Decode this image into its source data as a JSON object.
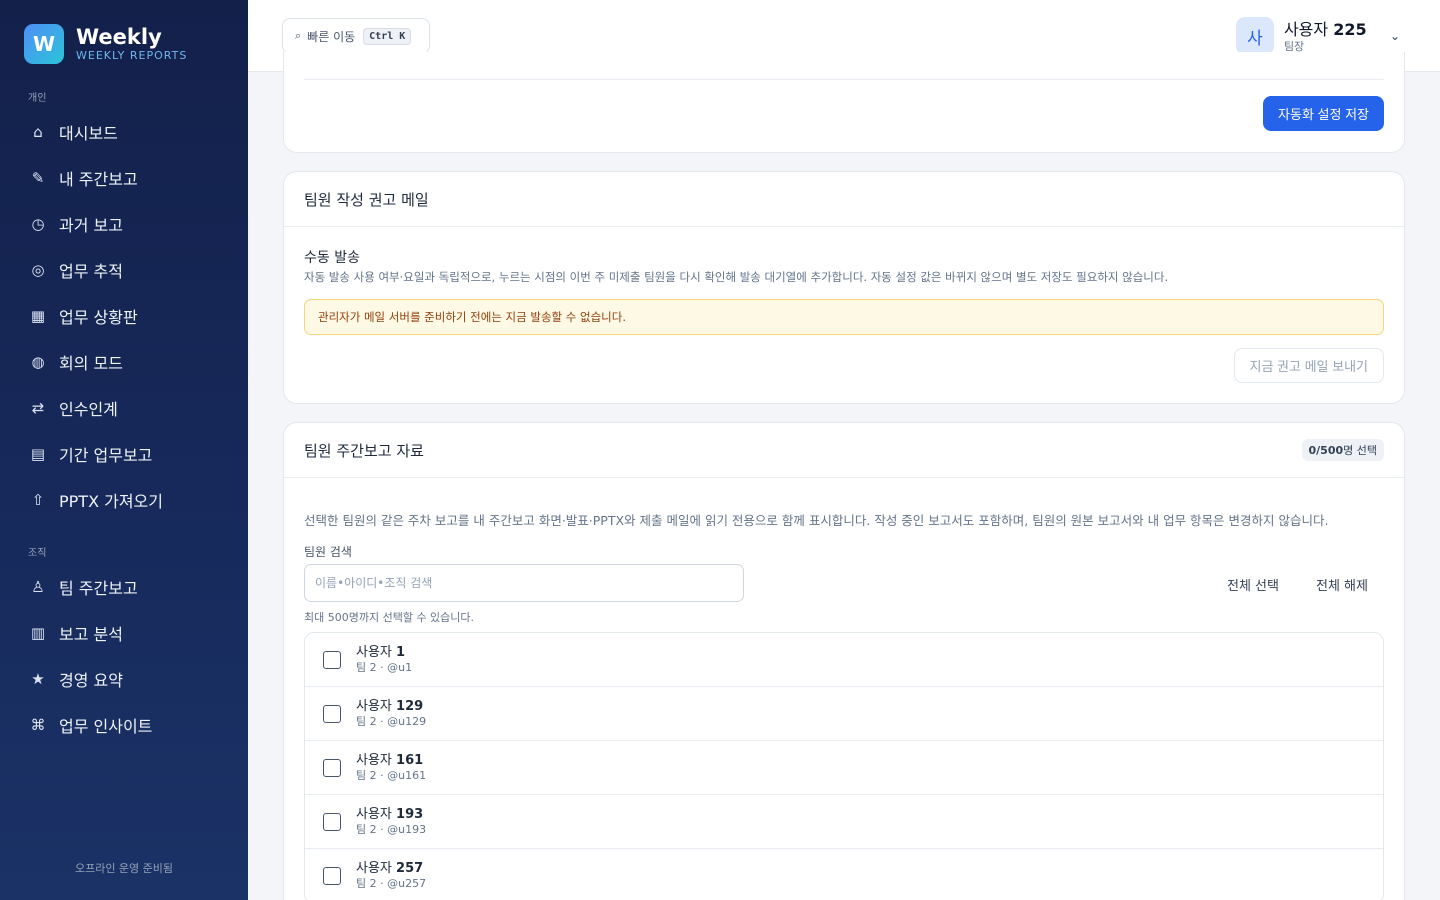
{
  "brand": {
    "logo_letter": "W",
    "name": "Weekly",
    "subtitle": "WEEKLY REPORTS"
  },
  "sidebar": {
    "personal_label": "개인",
    "personal_items": [
      {
        "icon": "⌂",
        "icon_name": "home-icon",
        "label": "대시보드"
      },
      {
        "icon": "✎",
        "icon_name": "pencil-icon",
        "label": "내 주간보고"
      },
      {
        "icon": "◷",
        "icon_name": "clock-icon",
        "label": "과거 보고"
      },
      {
        "icon": "◎",
        "icon_name": "target-icon",
        "label": "업무 추적"
      },
      {
        "icon": "▦",
        "icon_name": "grid-icon",
        "label": "업무 상황판"
      },
      {
        "icon": "◍",
        "icon_name": "meeting-icon",
        "label": "회의 모드"
      },
      {
        "icon": "⇄",
        "icon_name": "swap-icon",
        "label": "인수인계"
      },
      {
        "icon": "▤",
        "icon_name": "document-icon",
        "label": "기간 업무보고"
      },
      {
        "icon": "⇧",
        "icon_name": "upload-icon",
        "label": "PPTX 가져오기"
      }
    ],
    "org_label": "조직",
    "org_items": [
      {
        "icon": "♙",
        "icon_name": "team-icon",
        "label": "팀 주간보고"
      },
      {
        "icon": "▥",
        "icon_name": "chart-icon",
        "label": "보고 분석"
      },
      {
        "icon": "★",
        "icon_name": "star-icon",
        "label": "경영 요약"
      },
      {
        "icon": "⌘",
        "icon_name": "insight-icon",
        "label": "업무 인사이트"
      }
    ],
    "footer": "오프라인 운영 준비됨"
  },
  "header": {
    "quick_nav_icon": "⌕",
    "quick_nav_label": "빠른 이동",
    "quick_nav_shortcut": "Ctrl K",
    "avatar_letter": "사",
    "user_name_prefix": "사용자",
    "user_name_number": "225",
    "user_role": "팀장",
    "chevron": "⌄"
  },
  "automation_card": {
    "save_button": "자동화 설정 저장"
  },
  "reminder_card": {
    "title": "팀원 작성 권고 메일",
    "manual_title": "수동 발송",
    "manual_desc": "자동 발송 사용 여부·요일과 독립적으로, 누르는 시점의 이번 주 미제출 팀원을 다시 확인해 발송 대기열에 추가합니다. 자동 설정 값은 바뀌지 않으며 별도 저장도 필요하지 않습니다.",
    "alert": "관리자가 메일 서버를 준비하기 전에는 지금 발송할 수 없습니다.",
    "send_button": "지금 권고 메일 보내기"
  },
  "shared_card": {
    "title": "팀원 주간보고 자료",
    "badge_count": "0/500",
    "badge_suffix": "명 선택",
    "desc": "선택한 팀원의 같은 주차 보고를 내 주간보고 화면·발표·PPTX와 제출 메일에 읽기 전용으로 함께 표시합니다. 작성 중인 보고서도 포함하며, 팀원의 원본 보고서와 내 업무 항목은 변경하지 않습니다.",
    "search_label": "팀원 검색",
    "search_placeholder": "이름•아이디•조직 검색",
    "select_all": "전체 선택",
    "deselect_all": "전체 해제",
    "hint": "최대 500명까지 선택할 수 있습니다.",
    "members": [
      {
        "prefix": "사용자",
        "number": "1",
        "sub": "팀 2 · @u1"
      },
      {
        "prefix": "사용자",
        "number": "129",
        "sub": "팀 2 · @u129"
      },
      {
        "prefix": "사용자",
        "number": "161",
        "sub": "팀 2 · @u161"
      },
      {
        "prefix": "사용자",
        "number": "193",
        "sub": "팀 2 · @u193"
      },
      {
        "prefix": "사용자",
        "number": "257",
        "sub": "팀 2 · @u257"
      }
    ]
  }
}
